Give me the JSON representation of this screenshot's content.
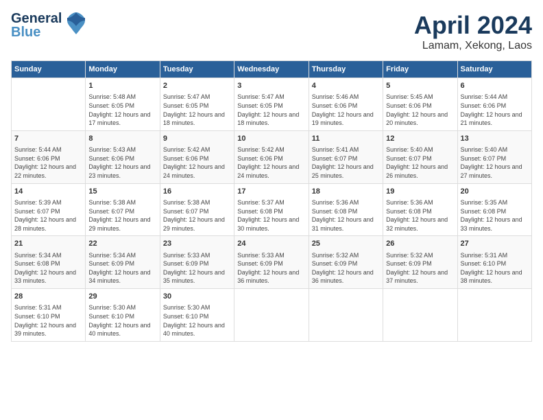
{
  "header": {
    "logo_line1": "General",
    "logo_line2": "Blue",
    "month": "April 2024",
    "location": "Lamam, Xekong, Laos"
  },
  "weekdays": [
    "Sunday",
    "Monday",
    "Tuesday",
    "Wednesday",
    "Thursday",
    "Friday",
    "Saturday"
  ],
  "weeks": [
    [
      {
        "day": null,
        "sunrise": null,
        "sunset": null,
        "daylight": null
      },
      {
        "day": "1",
        "sunrise": "5:48 AM",
        "sunset": "6:05 PM",
        "daylight": "12 hours and 17 minutes."
      },
      {
        "day": "2",
        "sunrise": "5:47 AM",
        "sunset": "6:05 PM",
        "daylight": "12 hours and 18 minutes."
      },
      {
        "day": "3",
        "sunrise": "5:47 AM",
        "sunset": "6:05 PM",
        "daylight": "12 hours and 18 minutes."
      },
      {
        "day": "4",
        "sunrise": "5:46 AM",
        "sunset": "6:06 PM",
        "daylight": "12 hours and 19 minutes."
      },
      {
        "day": "5",
        "sunrise": "5:45 AM",
        "sunset": "6:06 PM",
        "daylight": "12 hours and 20 minutes."
      },
      {
        "day": "6",
        "sunrise": "5:44 AM",
        "sunset": "6:06 PM",
        "daylight": "12 hours and 21 minutes."
      }
    ],
    [
      {
        "day": "7",
        "sunrise": "5:44 AM",
        "sunset": "6:06 PM",
        "daylight": "12 hours and 22 minutes."
      },
      {
        "day": "8",
        "sunrise": "5:43 AM",
        "sunset": "6:06 PM",
        "daylight": "12 hours and 23 minutes."
      },
      {
        "day": "9",
        "sunrise": "5:42 AM",
        "sunset": "6:06 PM",
        "daylight": "12 hours and 24 minutes."
      },
      {
        "day": "10",
        "sunrise": "5:42 AM",
        "sunset": "6:06 PM",
        "daylight": "12 hours and 24 minutes."
      },
      {
        "day": "11",
        "sunrise": "5:41 AM",
        "sunset": "6:07 PM",
        "daylight": "12 hours and 25 minutes."
      },
      {
        "day": "12",
        "sunrise": "5:40 AM",
        "sunset": "6:07 PM",
        "daylight": "12 hours and 26 minutes."
      },
      {
        "day": "13",
        "sunrise": "5:40 AM",
        "sunset": "6:07 PM",
        "daylight": "12 hours and 27 minutes."
      }
    ],
    [
      {
        "day": "14",
        "sunrise": "5:39 AM",
        "sunset": "6:07 PM",
        "daylight": "12 hours and 28 minutes."
      },
      {
        "day": "15",
        "sunrise": "5:38 AM",
        "sunset": "6:07 PM",
        "daylight": "12 hours and 29 minutes."
      },
      {
        "day": "16",
        "sunrise": "5:38 AM",
        "sunset": "6:07 PM",
        "daylight": "12 hours and 29 minutes."
      },
      {
        "day": "17",
        "sunrise": "5:37 AM",
        "sunset": "6:08 PM",
        "daylight": "12 hours and 30 minutes."
      },
      {
        "day": "18",
        "sunrise": "5:36 AM",
        "sunset": "6:08 PM",
        "daylight": "12 hours and 31 minutes."
      },
      {
        "day": "19",
        "sunrise": "5:36 AM",
        "sunset": "6:08 PM",
        "daylight": "12 hours and 32 minutes."
      },
      {
        "day": "20",
        "sunrise": "5:35 AM",
        "sunset": "6:08 PM",
        "daylight": "12 hours and 33 minutes."
      }
    ],
    [
      {
        "day": "21",
        "sunrise": "5:34 AM",
        "sunset": "6:08 PM",
        "daylight": "12 hours and 33 minutes."
      },
      {
        "day": "22",
        "sunrise": "5:34 AM",
        "sunset": "6:09 PM",
        "daylight": "12 hours and 34 minutes."
      },
      {
        "day": "23",
        "sunrise": "5:33 AM",
        "sunset": "6:09 PM",
        "daylight": "12 hours and 35 minutes."
      },
      {
        "day": "24",
        "sunrise": "5:33 AM",
        "sunset": "6:09 PM",
        "daylight": "12 hours and 36 minutes."
      },
      {
        "day": "25",
        "sunrise": "5:32 AM",
        "sunset": "6:09 PM",
        "daylight": "12 hours and 36 minutes."
      },
      {
        "day": "26",
        "sunrise": "5:32 AM",
        "sunset": "6:09 PM",
        "daylight": "12 hours and 37 minutes."
      },
      {
        "day": "27",
        "sunrise": "5:31 AM",
        "sunset": "6:10 PM",
        "daylight": "12 hours and 38 minutes."
      }
    ],
    [
      {
        "day": "28",
        "sunrise": "5:31 AM",
        "sunset": "6:10 PM",
        "daylight": "12 hours and 39 minutes."
      },
      {
        "day": "29",
        "sunrise": "5:30 AM",
        "sunset": "6:10 PM",
        "daylight": "12 hours and 40 minutes."
      },
      {
        "day": "30",
        "sunrise": "5:30 AM",
        "sunset": "6:10 PM",
        "daylight": "12 hours and 40 minutes."
      },
      {
        "day": null,
        "sunrise": null,
        "sunset": null,
        "daylight": null
      },
      {
        "day": null,
        "sunrise": null,
        "sunset": null,
        "daylight": null
      },
      {
        "day": null,
        "sunrise": null,
        "sunset": null,
        "daylight": null
      },
      {
        "day": null,
        "sunrise": null,
        "sunset": null,
        "daylight": null
      }
    ]
  ],
  "labels": {
    "sunrise": "Sunrise:",
    "sunset": "Sunset:",
    "daylight": "Daylight:"
  }
}
